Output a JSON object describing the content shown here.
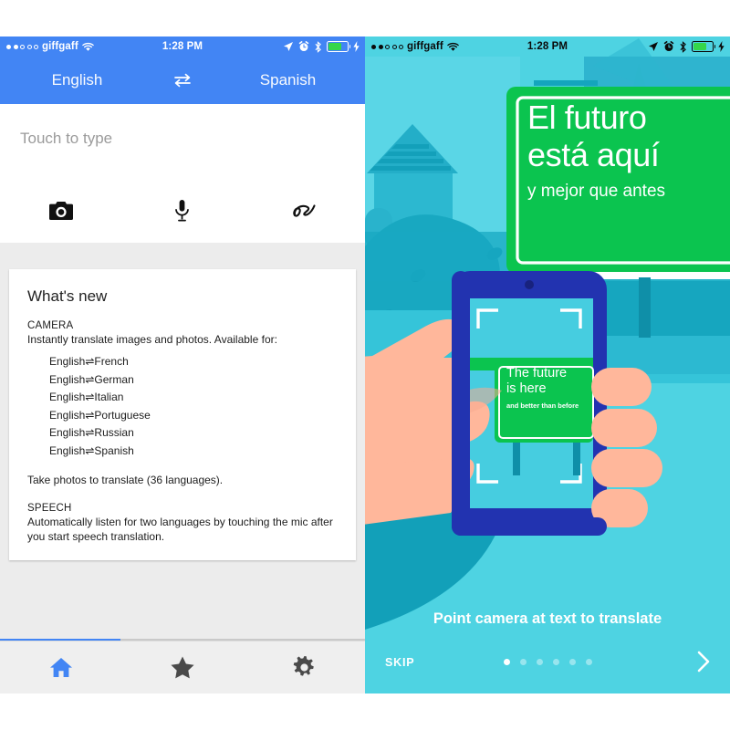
{
  "left_phone": {
    "status_bar": {
      "carrier": "giffgaff",
      "time": "1:28 PM",
      "signal_filled": 2,
      "signal_total": 5,
      "icons": [
        "wifi-icon",
        "location-arrow-icon",
        "alarm-clock-icon",
        "bluetooth-icon",
        "battery-icon",
        "charging-bolt-icon"
      ],
      "battery_percent": 62,
      "battery_color": "#35d64a",
      "bar_color": "#4285f4",
      "text_color": "#ffffff"
    },
    "language_bar": {
      "source_language": "English",
      "target_language": "Spanish",
      "swap_icon": "swap-horizontal-icon",
      "background": "#4285f4"
    },
    "input": {
      "placeholder": "Touch to type",
      "actions": [
        {
          "name": "camera-input",
          "icon": "camera-icon"
        },
        {
          "name": "voice-input",
          "icon": "microphone-icon"
        },
        {
          "name": "handwriting-input",
          "icon": "handwriting-icon"
        }
      ]
    },
    "whats_new_card": {
      "title": "What's new",
      "sections": [
        {
          "heading": "CAMERA",
          "body": "Instantly translate images and photos. Available for:",
          "pairs": [
            "English⇌French",
            "English⇌German",
            "English⇌Italian",
            "English⇌Portuguese",
            "English⇌Russian",
            "English⇌Spanish"
          ],
          "footer": "Take photos to translate (36 languages)."
        },
        {
          "heading": "SPEECH",
          "body": "Automatically listen for two languages by touching the mic after you start speech translation.",
          "pairs": [],
          "footer": ""
        }
      ]
    },
    "scroll_indicator": {
      "progress_percent": 33,
      "color": "#4285f4"
    },
    "tab_bar": {
      "items": [
        {
          "name": "tab-home",
          "icon": "home-icon",
          "active": true,
          "color": "#4285f4"
        },
        {
          "name": "tab-starred",
          "icon": "star-icon",
          "active": false,
          "color": "#4a4a4a"
        },
        {
          "name": "tab-settings",
          "icon": "gear-icon",
          "active": false,
          "color": "#4a4a4a"
        }
      ]
    }
  },
  "right_phone": {
    "status_bar": {
      "carrier": "giffgaff",
      "time": "1:28 PM",
      "signal_filled": 2,
      "signal_total": 5,
      "icons": [
        "wifi-icon",
        "location-arrow-icon",
        "alarm-clock-icon",
        "bluetooth-icon",
        "battery-icon",
        "charging-bolt-icon"
      ],
      "battery_percent": 62,
      "battery_color": "#35d64a",
      "bar_color": "#4ed3e2",
      "text_color": "#0a0a0a"
    },
    "illustration": {
      "road_sign": {
        "line1": "El futuro",
        "line2": "está aquí",
        "line3": "y mejor que antes",
        "sign_color": "#0bc44f",
        "border_color": "#ffffff"
      },
      "phone_screen_sign": {
        "line1": "The future",
        "line2": "is here",
        "line3": "and better than before",
        "sign_color": "#0bc44f"
      },
      "phone_bezel_color": "#2233b0",
      "hand_color": "#ffb79b",
      "sky_color": "#4ed3e2",
      "viewfinder": "camera-viewfinder-brackets"
    },
    "onboarding": {
      "caption": "Point camera at text to translate",
      "skip_label": "SKIP",
      "next_icon": "chevron-right-icon",
      "page_count": 6,
      "active_page": 1
    }
  }
}
